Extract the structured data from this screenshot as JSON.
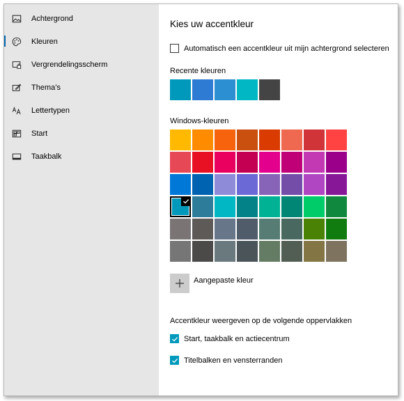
{
  "sidebar": {
    "items": [
      {
        "label": "Achtergrond",
        "icon": "picture-icon",
        "selected": false
      },
      {
        "label": "Kleuren",
        "icon": "palette-icon",
        "selected": true
      },
      {
        "label": "Vergrendelingsscherm",
        "icon": "lock-screen-icon",
        "selected": false
      },
      {
        "label": "Thema’s",
        "icon": "theme-icon",
        "selected": false
      },
      {
        "label": "Lettertypen",
        "icon": "font-icon",
        "selected": false
      },
      {
        "label": "Start",
        "icon": "start-icon",
        "selected": false
      },
      {
        "label": "Taakbalk",
        "icon": "taskbar-icon",
        "selected": false
      }
    ]
  },
  "main": {
    "title": "Kies uw accentkleur",
    "auto_accent": {
      "label": "Automatisch een accentkleur uit mijn achtergrond selecteren",
      "checked": false
    },
    "recent_label": "Recente kleuren",
    "recent_colors": [
      "#0099bc",
      "#2d7bd2",
      "#2b8fd1",
      "#00b7c3",
      "#444444"
    ],
    "windows_label": "Windows-kleuren",
    "windows_colors": [
      [
        "#ffb900",
        "#ff8c00",
        "#f7630c",
        "#ca5010",
        "#da3b01",
        "#ef6950",
        "#d13438",
        "#ff4343"
      ],
      [
        "#e74856",
        "#e81123",
        "#ea005e",
        "#c30052",
        "#e3008c",
        "#bf0077",
        "#c239b3",
        "#9a0089"
      ],
      [
        "#0078d7",
        "#0063b1",
        "#8e8cd8",
        "#6b69d6",
        "#8764b8",
        "#744da9",
        "#b146c2",
        "#881798"
      ],
      [
        "#0099bc",
        "#2d7d9a",
        "#00b7c3",
        "#038387",
        "#00b294",
        "#018574",
        "#00cc6a",
        "#10893e"
      ],
      [
        "#7a7574",
        "#5d5a58",
        "#68768a",
        "#515c6b",
        "#567c73",
        "#486860",
        "#498205",
        "#107c10"
      ],
      [
        "#767676",
        "#4c4a48",
        "#69797e",
        "#4a5459",
        "#647c64",
        "#525e54",
        "#847545",
        "#7e735f"
      ]
    ],
    "selected_color": "#0099bc",
    "custom_color_label": "Aangepaste kleur",
    "surfaces_label": "Accentkleur weergeven op de volgende oppervlakken",
    "surface_options": [
      {
        "label": "Start, taakbalk en actiecentrum",
        "checked": true
      },
      {
        "label": "Titelbalken en vensterranden",
        "checked": true
      }
    ],
    "accent_check_color": "#0099bc"
  }
}
